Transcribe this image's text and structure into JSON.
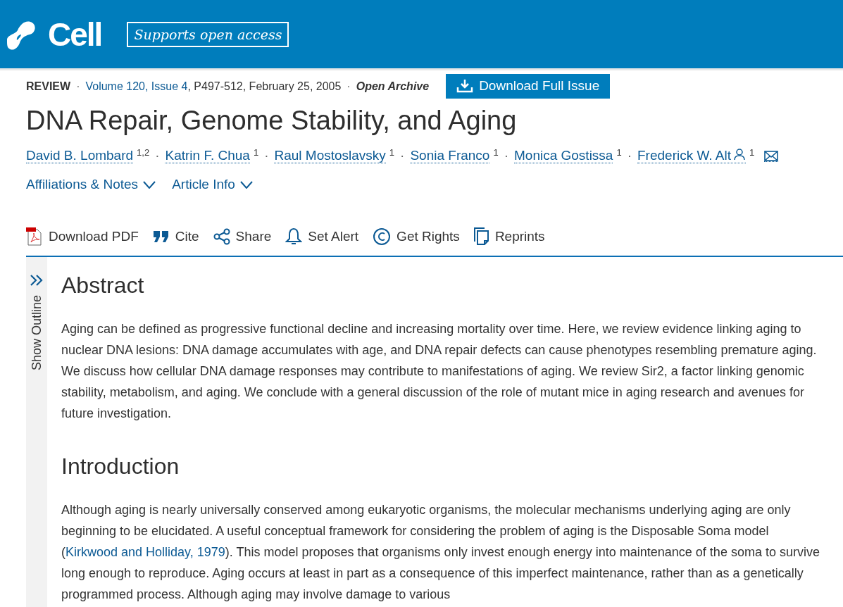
{
  "header": {
    "brand": "Cell",
    "badge": "Supports open access"
  },
  "separator": "·",
  "meta": {
    "type": "REVIEW",
    "issue_link": "Volume 120, Issue 4",
    "pages_date": ", P497-512, February 25, 2005",
    "access": "Open Archive",
    "download_button": "Download Full Issue"
  },
  "title": "DNA Repair, Genome Stability, and Aging",
  "authors": [
    {
      "name": "David B. Lombard",
      "affiliations": "1,2",
      "corresponding": false
    },
    {
      "name": "Katrin F. Chua",
      "affiliations": "1",
      "corresponding": false
    },
    {
      "name": "Raul Mostoslavsky",
      "affiliations": "1",
      "corresponding": false
    },
    {
      "name": "Sonia Franco",
      "affiliations": "1",
      "corresponding": false
    },
    {
      "name": "Monica Gostissa",
      "affiliations": "1",
      "corresponding": false
    },
    {
      "name": "Frederick W. Alt",
      "affiliations": "1",
      "corresponding": true
    }
  ],
  "expanders": [
    {
      "label": "Affiliations & Notes",
      "expanded": false
    },
    {
      "label": "Article Info",
      "expanded": false
    }
  ],
  "toolbar": [
    {
      "kind": "pdf",
      "label": "Download PDF"
    },
    {
      "kind": "cite",
      "label": "Cite"
    },
    {
      "kind": "share",
      "label": "Share"
    },
    {
      "kind": "alert",
      "label": "Set Alert"
    },
    {
      "kind": "rights",
      "label": "Get Rights"
    },
    {
      "kind": "reprints",
      "label": "Reprints"
    }
  ],
  "outline_toggle": "Show Outline",
  "sections": [
    {
      "heading": "Abstract",
      "parts": [
        {
          "kind": "text",
          "text": "Aging can be defined as progressive functional decline and increasing mortality over time. Here, we review evidence linking aging to nuclear DNA lesions: DNA damage accumulates with age, and DNA repair defects can cause phenotypes resembling premature aging. We discuss how cellular DNA damage responses may contribute to manifestations of aging. We review Sir2, a factor linking genomic stability, metabolism, and aging. We conclude with a general discussion of the role of mutant mice in aging research and avenues for future investigation."
        }
      ]
    },
    {
      "heading": "Introduction",
      "parts": [
        {
          "kind": "text",
          "text": "Although aging is nearly universally conserved among eukaryotic organisms, the molecular mechanisms underlying aging are only beginning to be elucidated. A useful conceptual framework for considering the problem of aging is the Disposable Soma model ("
        },
        {
          "kind": "link",
          "text": "Kirkwood and Holliday, 1979"
        },
        {
          "kind": "text",
          "text": "). This model proposes that organisms only invest enough energy into maintenance of the soma to survive long enough to reproduce. Aging occurs at least in part as a consequence of this imperfect maintenance, rather than as a genetically programmed process. Although aging may involve damage to various"
        }
      ]
    }
  ]
}
